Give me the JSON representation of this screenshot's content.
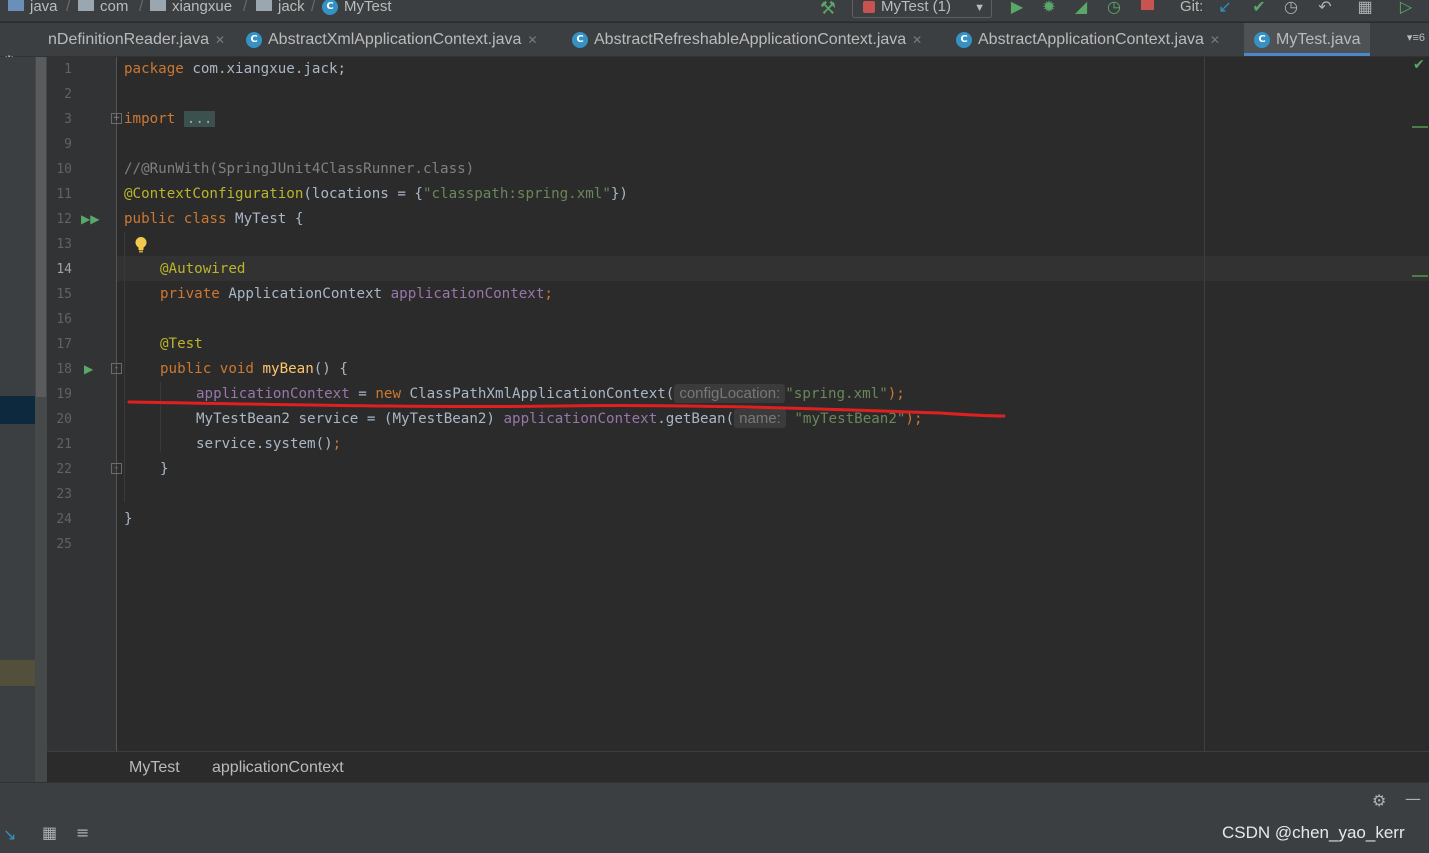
{
  "navbar": {
    "crumbs": [
      "java",
      "com",
      "xiangxue",
      "jack",
      "MyTest"
    ],
    "run_config": "MyTest (1)",
    "git_label": "Git:"
  },
  "tabs": [
    {
      "label": "nDefinitionReader.java",
      "active": false
    },
    {
      "label": "AbstractXmlApplicationContext.java",
      "active": false
    },
    {
      "label": "AbstractRefreshableApplicationContext.java",
      "active": false
    },
    {
      "label": "AbstractApplicationContext.java",
      "active": false
    },
    {
      "label": "MyTest.java",
      "active": true
    }
  ],
  "tab_overflow": "6",
  "editor": {
    "current_line": "14",
    "line_numbers": [
      "1",
      "2",
      "3",
      "9",
      "10",
      "11",
      "12",
      "13",
      "14",
      "15",
      "16",
      "17",
      "18",
      "19",
      "20",
      "21",
      "22",
      "23",
      "24",
      "25"
    ],
    "code": {
      "l1_kw": "package",
      "l1_rest": " com.xiangxue.jack;",
      "l3_kw": "import",
      "l3_fold": "...",
      "l10": "//@RunWith(SpringJUnit4ClassRunner.class)",
      "l11_ann": "@ContextConfiguration",
      "l11_a": "(locations = {",
      "l11_str": "\"classpath:spring.xml\"",
      "l11_b": "})",
      "l12_kw": "public class",
      "l12_rest": " MyTest {",
      "l14_ann": "@Autowired",
      "l15_kw": "private",
      "l15_type": " ApplicationContext ",
      "l15_fld": "applicationContext",
      "l15_end": ";",
      "l17_ann": "@Test",
      "l18_kw": "public void",
      "l18_mth": "myBean",
      "l18_rest": "() {",
      "l19_fld": "applicationContext",
      "l19_eq": " = ",
      "l19_new": "new",
      "l19_cls": " ClassPathXmlApplicationContext(",
      "l19_hint": "configLocation:",
      "l19_str": "\"spring.xml\"",
      "l19_end": ");",
      "l20_a": "MyTestBean2 service = (MyTestBean2) ",
      "l20_fld": "applicationContext",
      "l20_b": ".getBean(",
      "l20_hint": "name:",
      "l20_str": "\"myTestBean2\"",
      "l20_end": ");",
      "l21_a": "service.system()",
      "l21_end": ";",
      "l22": "}",
      "l24": "}"
    }
  },
  "breadcrumb": {
    "class_name": "MyTest",
    "member_name": "applicationContext"
  },
  "watermark": "CSDN @chen_yao_kerr",
  "colors": {
    "keyword": "#cc7832",
    "annotation": "#bbb529",
    "string": "#6a8759",
    "field": "#9876aa",
    "method": "#ffc66d",
    "comment": "#808080",
    "underline_mark": "#e02020"
  },
  "icons": [
    "folder-icon",
    "class-icon",
    "hammer-icon",
    "run-icon",
    "debug-icon",
    "coverage-icon",
    "profile-icon",
    "stop-icon",
    "git-update-icon",
    "git-commit-icon",
    "history-icon",
    "rollback-icon",
    "run-gutter-icon",
    "lightbulb-icon",
    "settings-icon",
    "minimize-icon",
    "checkmark-icon"
  ]
}
